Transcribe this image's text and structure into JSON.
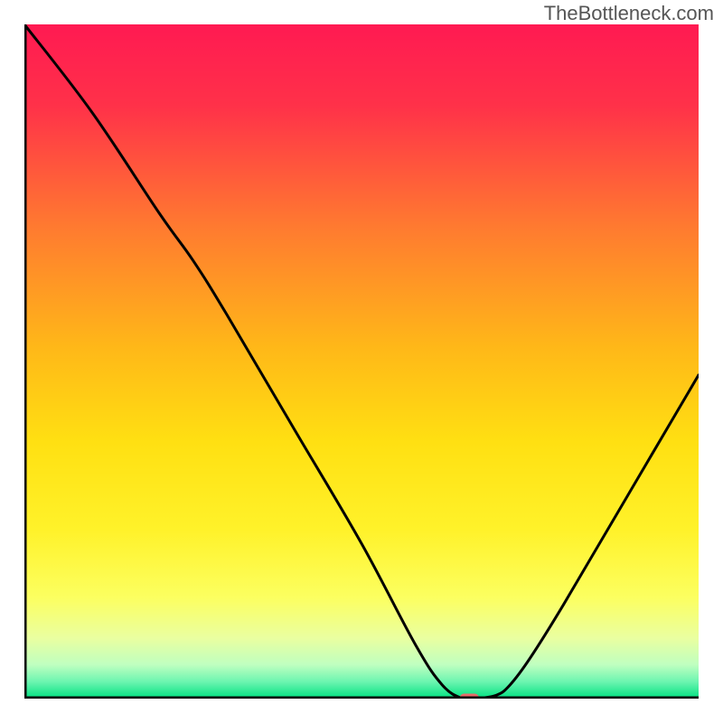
{
  "watermark": "TheBottleneck.com",
  "chart_data": {
    "type": "line",
    "title": "",
    "xlabel": "",
    "ylabel": "",
    "xlim": [
      0,
      100
    ],
    "ylim": [
      0,
      100
    ],
    "series": [
      {
        "name": "bottleneck-curve",
        "x": [
          0,
          10,
          20,
          25,
          30,
          40,
          50,
          58,
          62,
          65,
          67,
          70,
          72,
          75,
          80,
          90,
          100
        ],
        "values": [
          100,
          87,
          72,
          65,
          57,
          40,
          23,
          8,
          2,
          0,
          0,
          0.5,
          2,
          6,
          14,
          31,
          48
        ]
      }
    ],
    "marker": {
      "x": 66,
      "y": 0,
      "color": "#e86a6a",
      "shape": "rounded-rect"
    },
    "background_gradient": {
      "stops": [
        {
          "offset": 0.0,
          "color": "#ff1a52"
        },
        {
          "offset": 0.12,
          "color": "#ff3149"
        },
        {
          "offset": 0.3,
          "color": "#ff7a30"
        },
        {
          "offset": 0.48,
          "color": "#ffb818"
        },
        {
          "offset": 0.62,
          "color": "#ffe012"
        },
        {
          "offset": 0.75,
          "color": "#fff22a"
        },
        {
          "offset": 0.85,
          "color": "#fcff60"
        },
        {
          "offset": 0.91,
          "color": "#eaffa0"
        },
        {
          "offset": 0.95,
          "color": "#bfffc0"
        },
        {
          "offset": 0.975,
          "color": "#6cf5b0"
        },
        {
          "offset": 1.0,
          "color": "#00e080"
        }
      ]
    },
    "line_color": "#000000",
    "axis_color": "#000000"
  }
}
